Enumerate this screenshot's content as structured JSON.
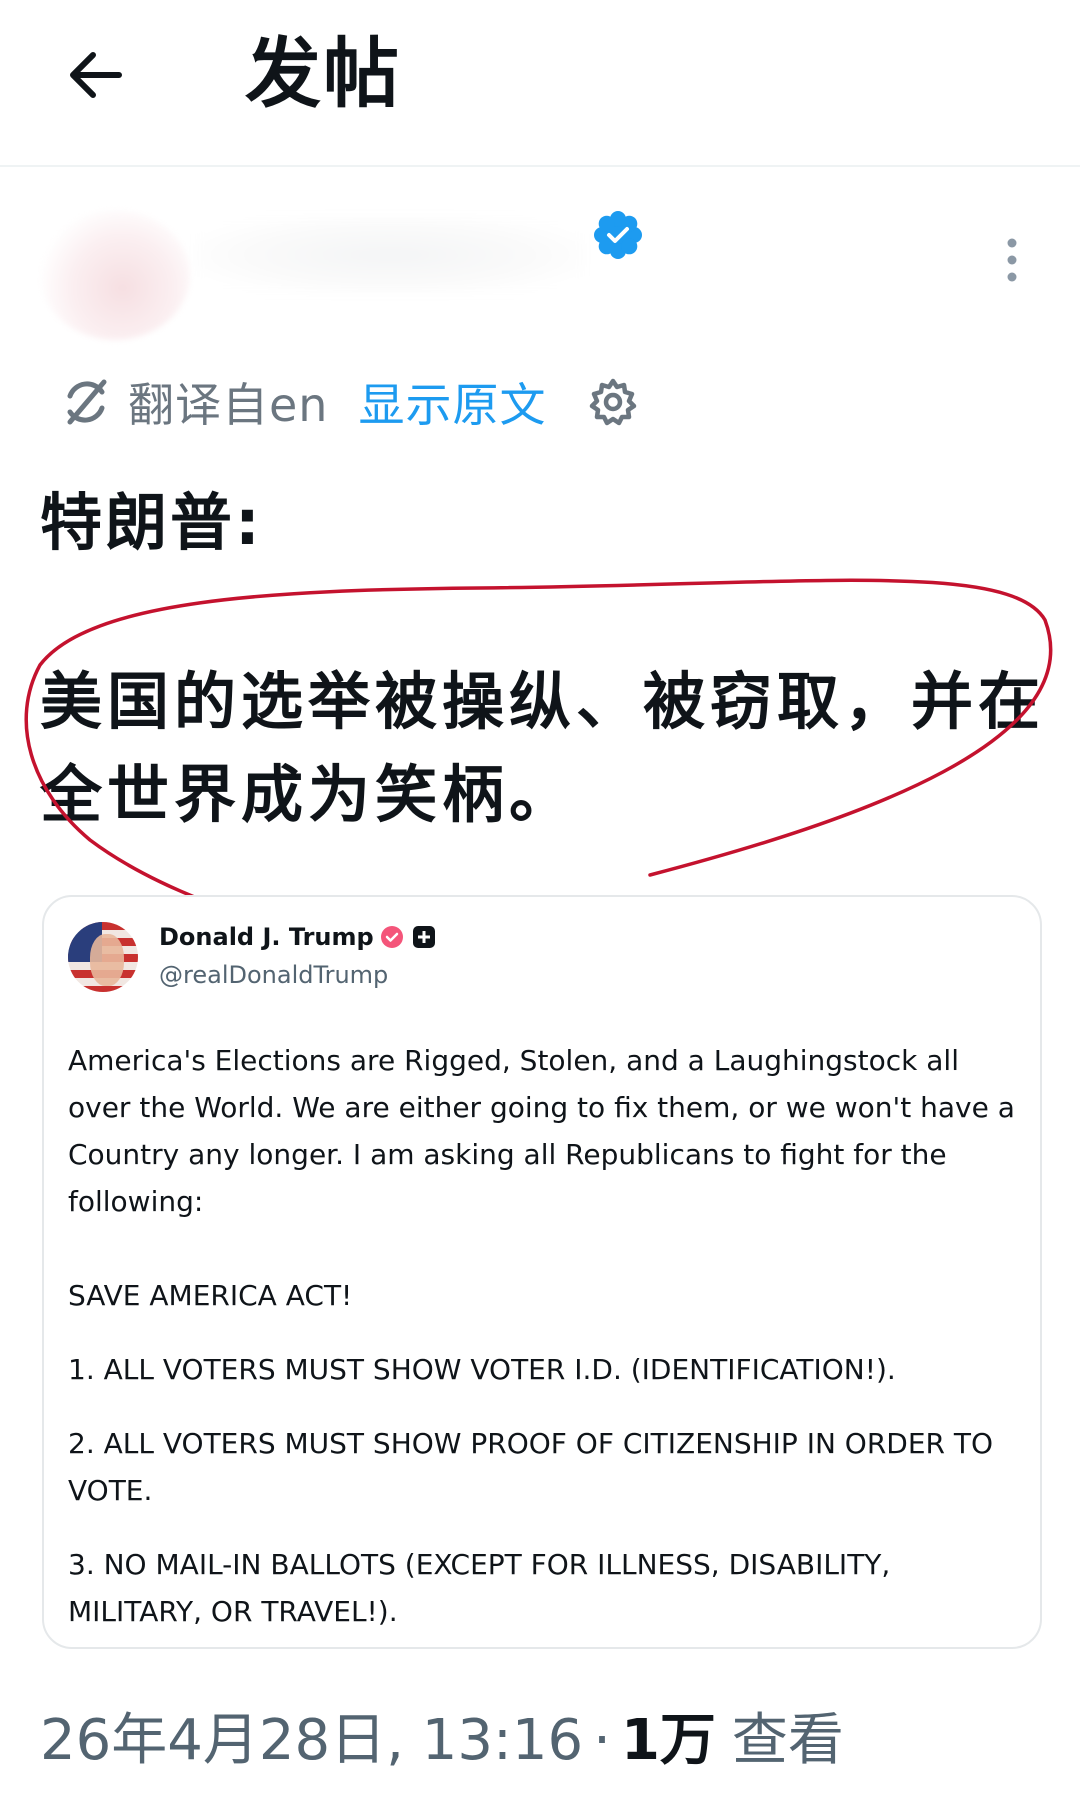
{
  "header": {
    "title": "发帖"
  },
  "translation": {
    "label": "翻译自en",
    "show_original": "显示原文"
  },
  "post": {
    "speaker": "特朗普:",
    "body": "美国的选举被操纵、被窃取，并在全世界成为笑柄。"
  },
  "quoted": {
    "name": "Donald J. Trump",
    "handle": "@realDonaldTrump",
    "paragraphs": [
      "America's Elections are Rigged, Stolen, and a Laughingstock all over the World. We are either going to fix them, or we won't have a Country any longer. I am asking all Republicans to fight for the following:",
      "SAVE AMERICA ACT!",
      "1. ALL VOTERS MUST SHOW VOTER I.D. (IDENTIFICATION!).",
      "2. ALL VOTERS MUST SHOW PROOF OF CITIZENSHIP IN ORDER TO VOTE.",
      "3. NO MAIL-IN BALLOTS (EXCEPT FOR ILLNESS, DISABILITY, MILITARY, OR TRAVEL!)."
    ]
  },
  "meta": {
    "timestamp": "26年4月28日, 13:16",
    "separator": "·",
    "views_count": "1万",
    "views_label": "查看"
  },
  "colors": {
    "accent": "#1d9bf0",
    "secondary_text": "#536471",
    "annotation_ink": "#c4122e",
    "verified": "#1d9bf0",
    "quoted_verified": "#f4557a"
  },
  "icons": [
    "back-arrow-icon",
    "verified-badge-icon",
    "more-vertical-icon",
    "translate-icon",
    "settings-gear-icon"
  ]
}
